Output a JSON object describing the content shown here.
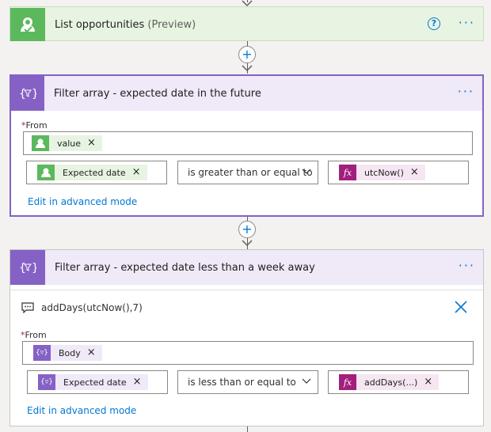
{
  "list_card": {
    "title": "List opportunities",
    "suffix": "(Preview)",
    "help_icon": "question-circle-icon",
    "color": "#5cb85c"
  },
  "filter1": {
    "title": "Filter array - expected date in the future",
    "from_label": "From",
    "from_token": "value",
    "left_token": "Expected date",
    "operator": "is greater than or equal to",
    "right_token": "utcNow()",
    "advanced_link": "Edit in advanced mode",
    "color": "#8661c5"
  },
  "filter2": {
    "title": "Filter array - expected date less than a week away",
    "comment_text": "addDays(utcNow(),7)",
    "from_label": "From",
    "from_token": "Body",
    "left_token": "Expected date",
    "operator": "is less than or equal to",
    "right_token": "addDays(...)",
    "advanced_link": "Edit in advanced mode",
    "color": "#8661c5"
  },
  "common": {
    "required_mark": "*",
    "token_remove": "×",
    "more": "···",
    "plus": "+",
    "fx": "fx"
  }
}
